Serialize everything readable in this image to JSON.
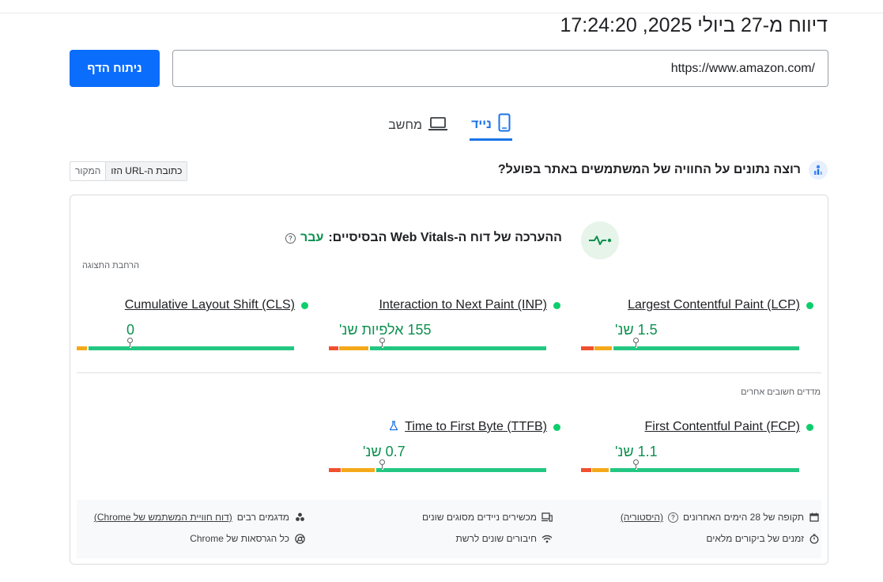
{
  "header": {
    "report_title": "דיווח מ-27 ביולי 2025, 17:24:20"
  },
  "search": {
    "url_value": "https://www.amazon.com/",
    "analyze_label": "ניתוח הדף"
  },
  "tabs": [
    {
      "label": "נייד",
      "icon": "phone-icon",
      "selected": true
    },
    {
      "label": "מחשב",
      "icon": "laptop-icon",
      "selected": false
    }
  ],
  "crux": {
    "question": "רוצה נתונים על החוויה של המשתמשים באתר בפועל?",
    "toggle_on": "כתובת ה-URL הזו",
    "toggle_off": "המקור"
  },
  "assessment": {
    "label": "ההערכה של דוח ה-Web Vitals הבסיסיים:",
    "status": "עבר",
    "expand": "הרחבת התצוגה"
  },
  "core_metrics": [
    {
      "name": "Largest Contentful Paint (LCP)",
      "value": "1.5 שנ'"
    },
    {
      "name": "Interaction to Next Paint (INP)",
      "value": "155 אלפיות שנ'"
    },
    {
      "name": "Cumulative Layout Shift (CLS)",
      "value": "0"
    }
  ],
  "other_label": "מדדים חשובים אחרים",
  "other_metrics": [
    {
      "name": "First Contentful Paint (FCP)",
      "value": "1.1 שנ'"
    },
    {
      "name": "Time to First Byte (TTFB)",
      "value": "0.7 שנ'"
    }
  ],
  "footer": {
    "period": "תקופה של 28 הימים האחרונים",
    "history_link": "(היסטוריה)",
    "devices": "מכשירים ניידים מסוגים שונים",
    "samples": "מדגמים רבים",
    "crux_link": "(דוח חוויית המשתמש של Chrome)",
    "visits": "זמנים של ביקורים מלאים",
    "network": "חיבורים שונים לרשת",
    "chrome": "כל הגרסאות של Chrome"
  },
  "colors": {
    "accent": "#1a73e8",
    "button": "#0b6dfc",
    "pass": "#0d904f",
    "good": "#0cce6b",
    "poor": "#f1502e",
    "needs_improvement": "#f4a91a"
  }
}
